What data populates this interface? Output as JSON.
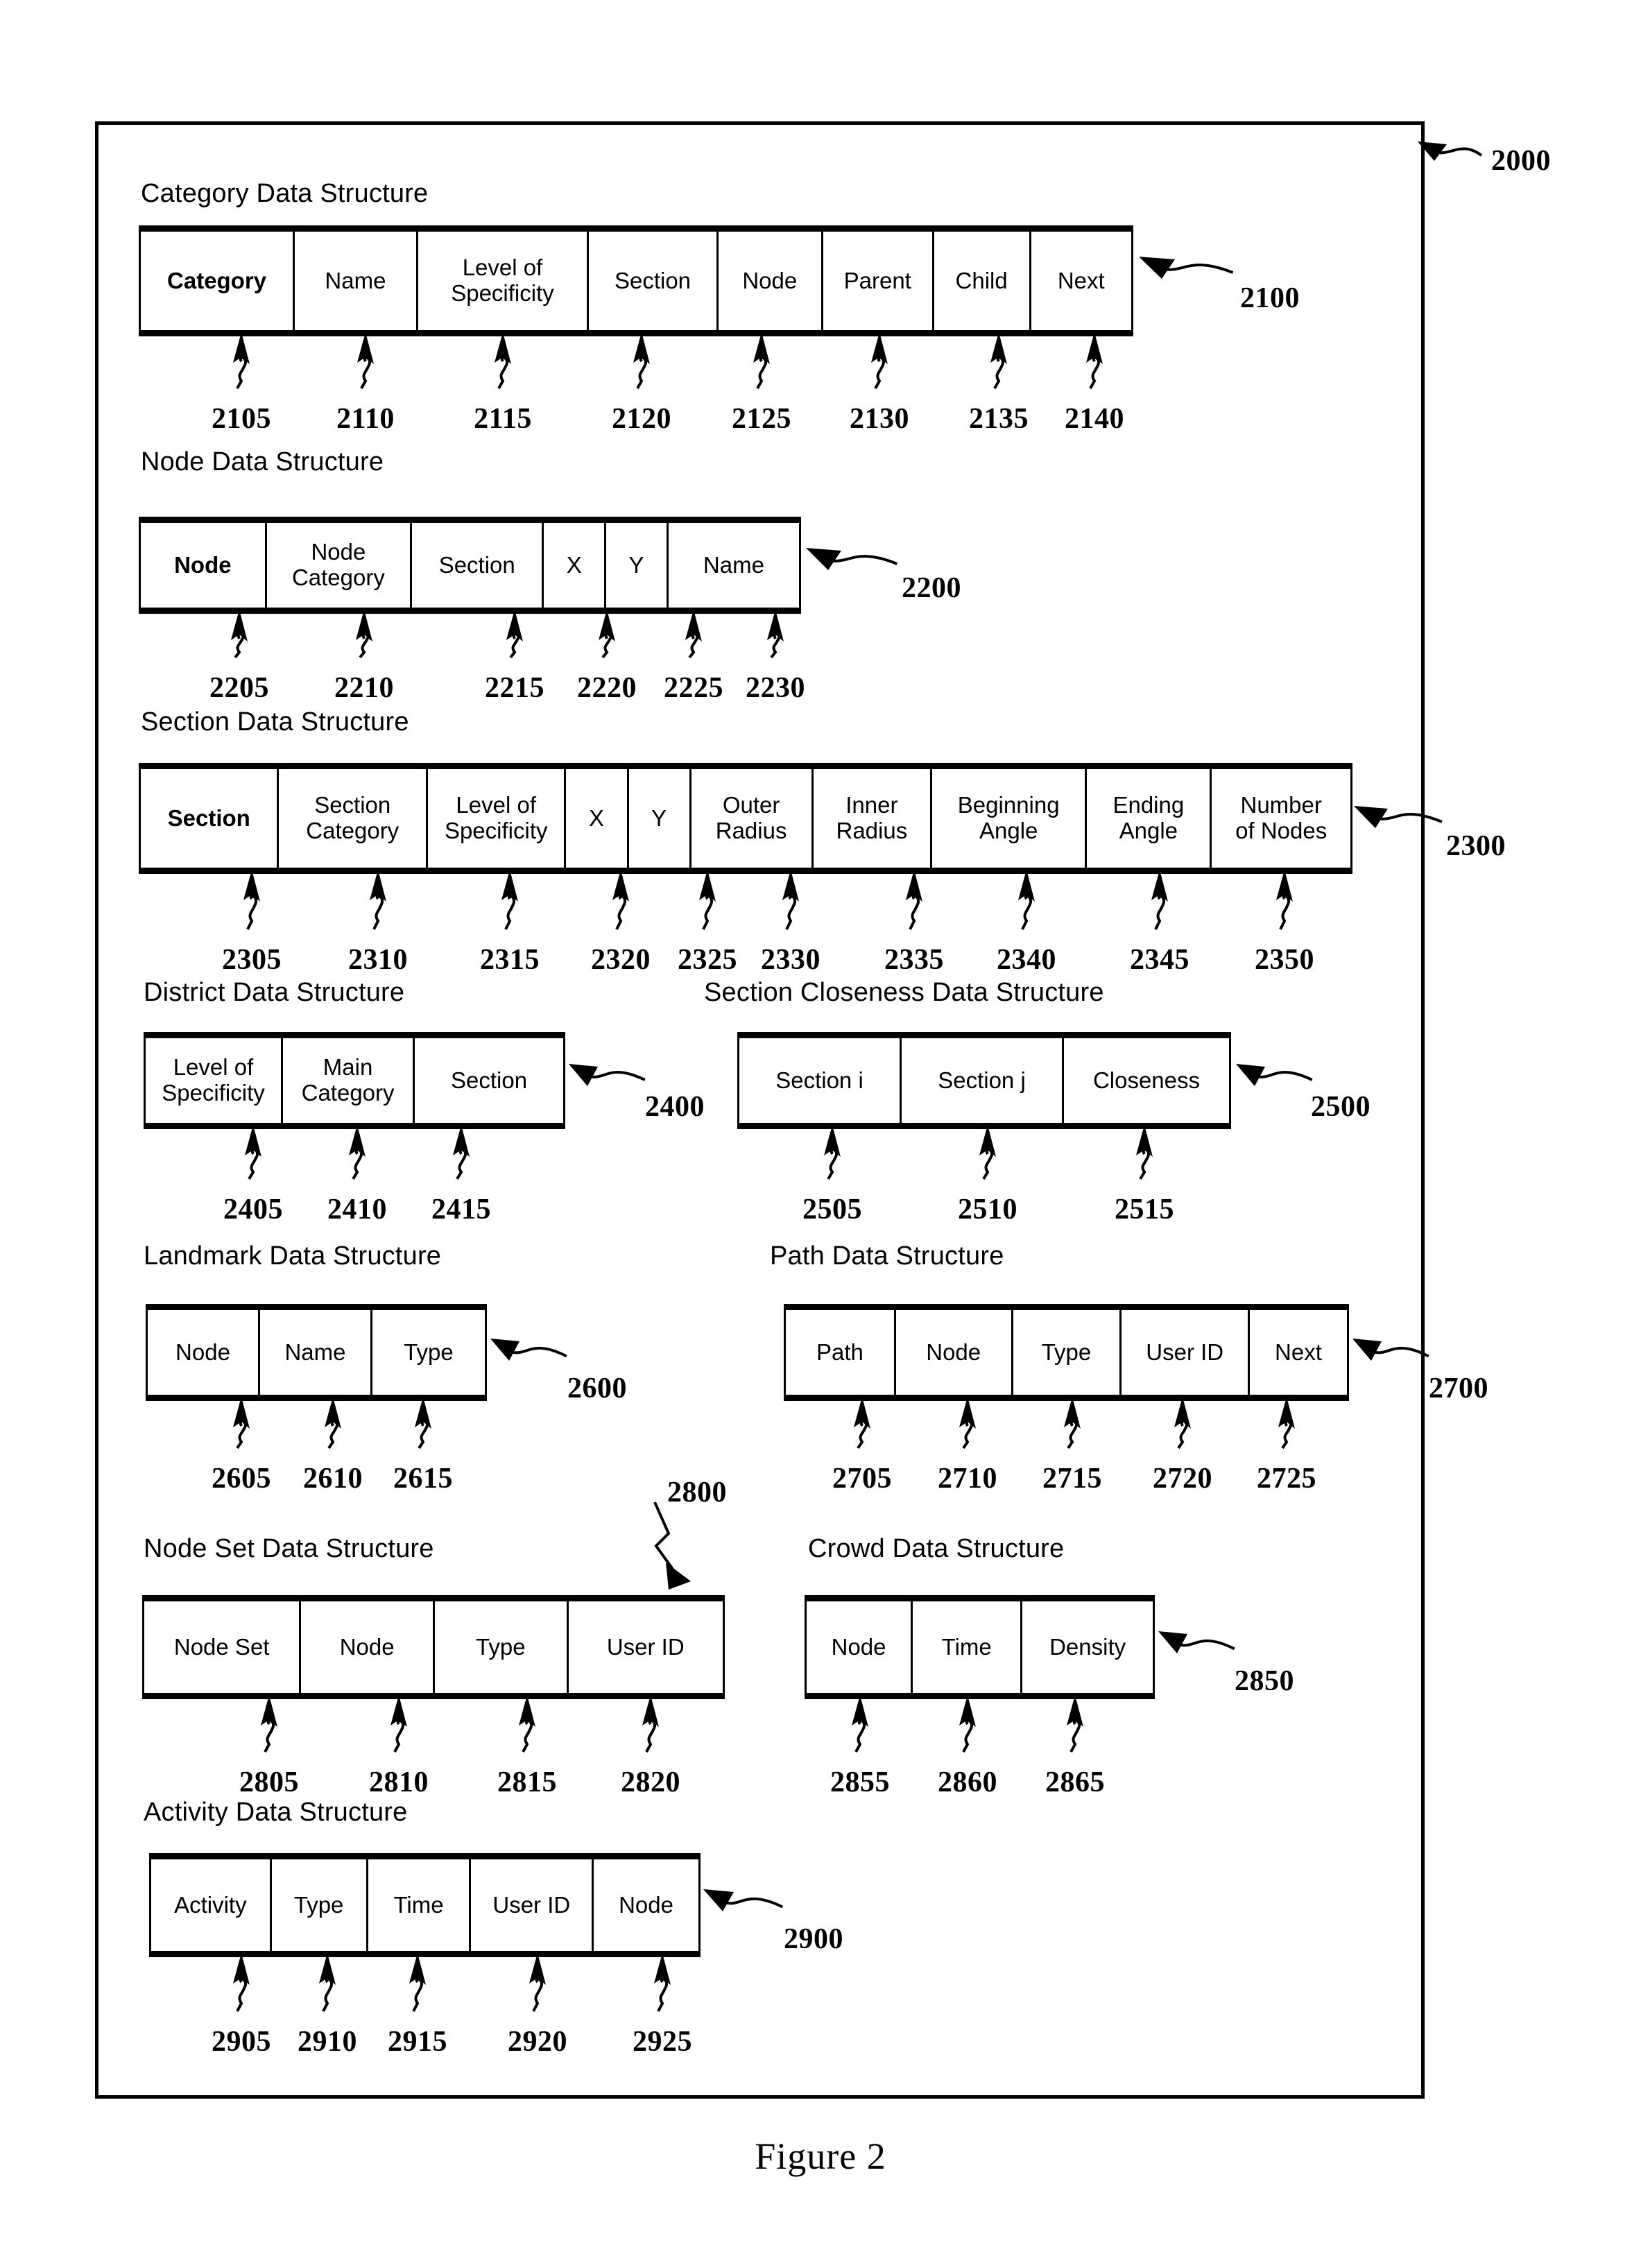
{
  "figure": {
    "caption": "Figure 2",
    "frame_ref": "2000"
  },
  "structures": [
    {
      "id": "category",
      "title": "Category Data Structure",
      "ref": "2100",
      "fields": [
        {
          "label": "Category",
          "ref": "2105",
          "bold": true
        },
        {
          "label": "Name",
          "ref": "2110",
          "bold": false
        },
        {
          "label": "Level of\nSpecificity",
          "ref": "2115",
          "bold": false
        },
        {
          "label": "Section",
          "ref": "2120",
          "bold": false
        },
        {
          "label": "Node",
          "ref": "2125",
          "bold": false
        },
        {
          "label": "Parent",
          "ref": "2130",
          "bold": false
        },
        {
          "label": "Child",
          "ref": "2135",
          "bold": false
        },
        {
          "label": "Next",
          "ref": "2140",
          "bold": false
        }
      ]
    },
    {
      "id": "node",
      "title": "Node Data Structure",
      "ref": "2200",
      "fields": [
        {
          "label": "Node",
          "ref": "2205",
          "bold": true
        },
        {
          "label": "Node\nCategory",
          "ref": "2210",
          "bold": false
        },
        {
          "label": "Section",
          "ref": "2215",
          "bold": false
        },
        {
          "label": "X",
          "ref": "2220",
          "bold": false
        },
        {
          "label": "Y",
          "ref": "2225",
          "bold": false
        },
        {
          "label": "Name",
          "ref": "2230",
          "bold": false
        }
      ]
    },
    {
      "id": "section",
      "title": "Section Data Structure",
      "ref": "2300",
      "fields": [
        {
          "label": "Section",
          "ref": "2305",
          "bold": true
        },
        {
          "label": "Section\nCategory",
          "ref": "2310",
          "bold": false
        },
        {
          "label": "Level of\nSpecificity",
          "ref": "2315",
          "bold": false
        },
        {
          "label": "X",
          "ref": "2320",
          "bold": false
        },
        {
          "label": "Y",
          "ref": "2325",
          "bold": false
        },
        {
          "label": "Outer\nRadius",
          "ref": "2330",
          "bold": false
        },
        {
          "label": "Inner\nRadius",
          "ref": "2335",
          "bold": false
        },
        {
          "label": "Beginning\nAngle",
          "ref": "2340",
          "bold": false
        },
        {
          "label": "Ending\nAngle",
          "ref": "2345",
          "bold": false
        },
        {
          "label": "Number\nof Nodes",
          "ref": "2350",
          "bold": false
        }
      ]
    },
    {
      "id": "district",
      "title": "District Data Structure",
      "ref": "2400",
      "fields": [
        {
          "label": "Level of\nSpecificity",
          "ref": "2405",
          "bold": false
        },
        {
          "label": "Main\nCategory",
          "ref": "2410",
          "bold": false
        },
        {
          "label": "Section",
          "ref": "2415",
          "bold": false
        }
      ]
    },
    {
      "id": "section-closeness",
      "title": "Section Closeness Data Structure",
      "ref": "2500",
      "fields": [
        {
          "label": "Section i",
          "ref": "2505",
          "bold": false
        },
        {
          "label": "Section j",
          "ref": "2510",
          "bold": false
        },
        {
          "label": "Closeness",
          "ref": "2515",
          "bold": false
        }
      ]
    },
    {
      "id": "landmark",
      "title": "Landmark Data Structure",
      "ref": "2600",
      "fields": [
        {
          "label": "Node",
          "ref": "2605",
          "bold": false
        },
        {
          "label": "Name",
          "ref": "2610",
          "bold": false
        },
        {
          "label": "Type",
          "ref": "2615",
          "bold": false
        }
      ]
    },
    {
      "id": "path",
      "title": "Path Data Structure",
      "ref": "2700",
      "fields": [
        {
          "label": "Path",
          "ref": "2705",
          "bold": false
        },
        {
          "label": "Node",
          "ref": "2710",
          "bold": false
        },
        {
          "label": "Type",
          "ref": "2715",
          "bold": false
        },
        {
          "label": "User ID",
          "ref": "2720",
          "bold": false
        },
        {
          "label": "Next",
          "ref": "2725",
          "bold": false
        }
      ]
    },
    {
      "id": "node-set",
      "title": "Node Set Data Structure",
      "ref": "2800",
      "fields": [
        {
          "label": "Node Set",
          "ref": "2805",
          "bold": false
        },
        {
          "label": "Node",
          "ref": "2810",
          "bold": false
        },
        {
          "label": "Type",
          "ref": "2815",
          "bold": false
        },
        {
          "label": "User ID",
          "ref": "2820",
          "bold": false
        }
      ]
    },
    {
      "id": "crowd",
      "title": "Crowd Data Structure",
      "ref": "2850",
      "fields": [
        {
          "label": "Node",
          "ref": "2855",
          "bold": false
        },
        {
          "label": "Time",
          "ref": "2860",
          "bold": false
        },
        {
          "label": "Density",
          "ref": "2865",
          "bold": false
        }
      ]
    },
    {
      "id": "activity",
      "title": "Activity Data Structure",
      "ref": "2900",
      "fields": [
        {
          "label": "Activity",
          "ref": "2905",
          "bold": false
        },
        {
          "label": "Type",
          "ref": "2910",
          "bold": false
        },
        {
          "label": "Time",
          "ref": "2915",
          "bold": false
        },
        {
          "label": "User ID",
          "ref": "2920",
          "bold": false
        },
        {
          "label": "Node",
          "ref": "2925",
          "bold": false
        }
      ]
    }
  ]
}
